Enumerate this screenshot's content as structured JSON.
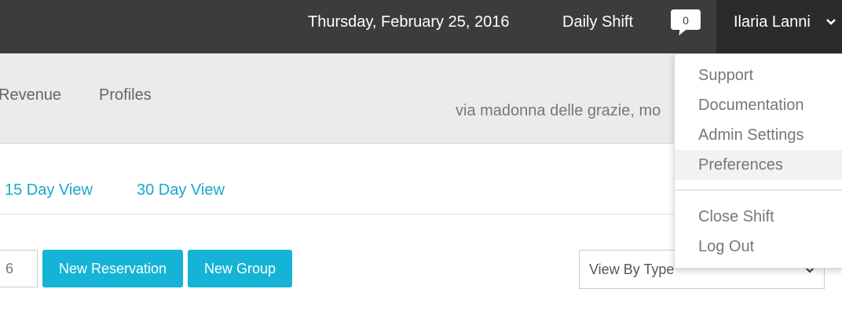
{
  "topbar": {
    "date": "Thursday, February 25, 2016",
    "shift": "Daily Shift",
    "notifications": "0",
    "user": "Ilaria Lanni"
  },
  "nav": {
    "items": [
      "Revenue",
      "Profiles"
    ],
    "address": "via madonna delle grazie, mo"
  },
  "views": {
    "fifteen": "15 Day View",
    "thirty": "30 Day View"
  },
  "controls": {
    "number_value": "6",
    "new_reservation": "New Reservation",
    "new_group": "New Group",
    "view_by": "View By Type"
  },
  "dropdown": {
    "items": [
      "Support",
      "Documentation",
      "Admin Settings",
      "Preferences"
    ],
    "items2": [
      "Close Shift",
      "Log Out"
    ],
    "active": "Preferences"
  },
  "colors": {
    "topbar": "#3c3c3c",
    "accent": "#15b3d6",
    "link": "#1aa8c8"
  }
}
